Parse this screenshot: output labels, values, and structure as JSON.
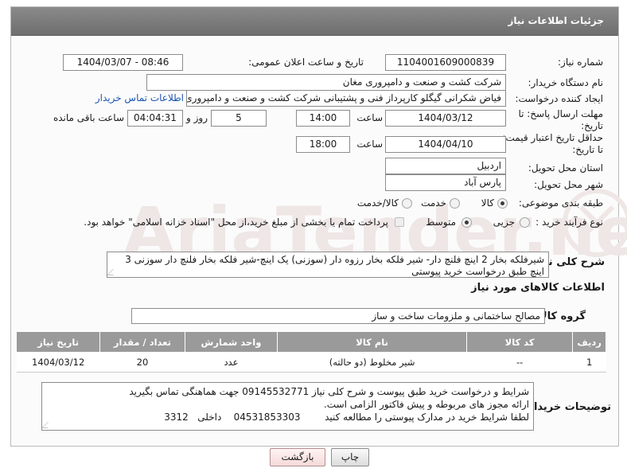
{
  "header": {
    "title": "جزئیات اطلاعات نیاز"
  },
  "fields": {
    "need_number": {
      "label": "شماره نیاز:",
      "value": "1104001609000839"
    },
    "announce_datetime": {
      "label": "تاریخ و ساعت اعلان عمومی:",
      "value": "1404/03/07 - 08:46"
    },
    "buyer_org": {
      "label": "نام دستگاه خریدار:",
      "value": "شرکت کشت و صنعت و دامپروری مغان"
    },
    "requester": {
      "label": "ایجاد کننده درخواست:",
      "value": "فیاض شکرانی گیگلو کارپرداز فنی و پشتیبانی شرکت کشت و صنعت و دامپروری",
      "contact_link": "اطلاعات تماس خریدار"
    },
    "reply_deadline": {
      "label_line1": "مهلت ارسال پاسخ: تا",
      "label_line2": "تاریخ:",
      "date": "1404/03/12",
      "time_label": "ساعت",
      "time": "14:00",
      "days": "5",
      "days_label": "روز و",
      "remaining": "04:04:31",
      "remaining_label": "ساعت باقی مانده"
    },
    "price_validity": {
      "label_line1": "حداقل تاریخ اعتبار قیمت:",
      "label_line2": "تا تاریخ:",
      "date": "1404/04/10",
      "time_label": "ساعت",
      "time": "18:00"
    },
    "delivery_province": {
      "label": "استان محل تحویل:",
      "value": "اردبیل"
    },
    "delivery_city": {
      "label": "شهر محل تحویل:",
      "value": "پارس آباد"
    },
    "category": {
      "label": "طبقه بندی موضوعی:",
      "options": [
        "کالا",
        "خدمت",
        "کالا/خدمت"
      ],
      "selected": "کالا"
    },
    "process_type": {
      "label": "نوع فرآیند خرید :",
      "options": [
        "جزیی",
        "متوسط"
      ],
      "selected": "متوسط",
      "note": "پرداخت تمام یا بخشی از مبلغ خرید،از محل \"اسناد خزانه اسلامی\" خواهد بود."
    },
    "general_desc": {
      "label": "شرح کلی نیاز:",
      "value": "شیرفلکه بخار 2 اینچ فلنچ دار- شیر فلکه بخار رزوه دار (سوزنی) یک اینچ-شیر فلکه بخار فلنچ دار سوزنی 3 اینچ طبق درخواست خرید پیوستی"
    }
  },
  "goods_section": {
    "title": "اطلاعات کالاهای مورد نیاز",
    "group_label": "گروه کالا:",
    "group_value": "مصالح ساختمانی و ملزومات ساخت و ساز",
    "columns": [
      "ردیف",
      "کد کالا",
      "نام کالا",
      "واحد شمارش",
      "تعداد / مقدار",
      "تاریخ نیاز"
    ],
    "rows": [
      [
        "1",
        "--",
        "شیر مخلوط (دو حالته)",
        "عدد",
        "20",
        "1404/03/12"
      ]
    ]
  },
  "buyer_notes": {
    "label": "توضیحات خریدار:",
    "lines": [
      "شرایط و درخواست خرید طبق پیوست و شرح کلی نیاز 09145532771 جهت هماهنگی تماس بگیرید",
      "ارائه مجوز های مربوطه و پیش فاکتور الزامی است.",
      "لطفا شرایط خرید در مدارک پیوستی را مطالعه کنید        04531853303    داخلی   3312"
    ]
  },
  "buttons": {
    "print": "چاپ",
    "back": "بازگشت"
  },
  "watermark": {
    "text": "AriaTender.net"
  }
}
